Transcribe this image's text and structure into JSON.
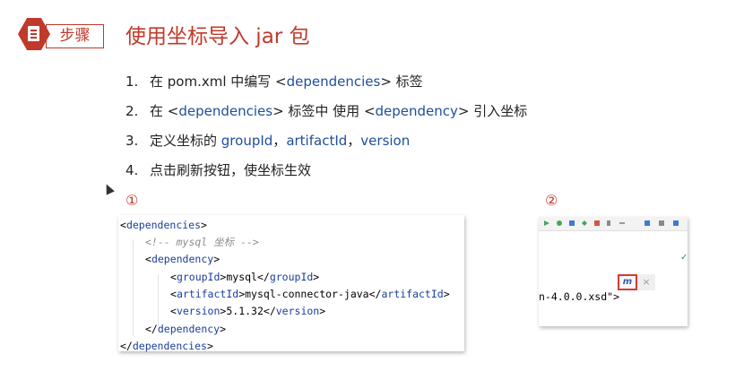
{
  "header": {
    "step_label": "步骤",
    "title": "使用坐标导入 jar 包"
  },
  "steps": [
    {
      "num": "1.",
      "parts": [
        "在 pom.xml 中编写 <",
        "dependencies",
        "> 标签"
      ]
    },
    {
      "num": "2.",
      "parts": [
        "在 <",
        "dependencies",
        "> 标签中 使用 <",
        "dependency",
        "> 引入坐标"
      ]
    },
    {
      "num": "3.",
      "parts": [
        "定义坐标的 ",
        "groupId",
        "，",
        "artifactId",
        "，",
        "version"
      ]
    },
    {
      "num": "4.",
      "parts": [
        "点击刷新按钮，使坐标生效"
      ]
    }
  ],
  "markers": {
    "one": "①",
    "two": "②"
  },
  "code": {
    "lines": [
      {
        "p1": "<",
        "t1": "dependencies",
        "p2": ">"
      },
      {
        "comment": "<!-- mysql 坐标 -->"
      },
      {
        "p1": "<",
        "t1": "dependency",
        "p2": ">"
      },
      {
        "p1": "<",
        "t1": "groupId",
        "p2": ">",
        "val": "mysql",
        "p3": "</",
        "t2": "groupId",
        "p4": ">"
      },
      {
        "p1": "<",
        "t1": "artifactId",
        "p2": ">",
        "val": "mysql-connector-java",
        "p3": "</",
        "t2": "artifactId",
        "p4": ">"
      },
      {
        "p1": "<",
        "t1": "version",
        "p2": ">",
        "val": "5.1.32",
        "p3": "</",
        "t2": "version",
        "p4": ">"
      },
      {
        "p1": "</",
        "t1": "dependency",
        "p2": ">"
      },
      {
        "p1": "</",
        "t1": "dependencies",
        "p2": ">"
      }
    ]
  },
  "ide": {
    "code_text": "n-4.0.0.xsd\">",
    "maven_button_label": "m",
    "close_label": "×",
    "check_glyph": "✓"
  },
  "colors": {
    "accent": "#c0392b",
    "keyword": "#1f4e9c",
    "xml_tag": "#1a3d9c",
    "comment": "#8c8c8c"
  },
  "icons": {
    "header": "document-icon",
    "cursor": "mouse-cursor-icon",
    "maven": "maven-reload-icon",
    "close": "close-icon"
  }
}
